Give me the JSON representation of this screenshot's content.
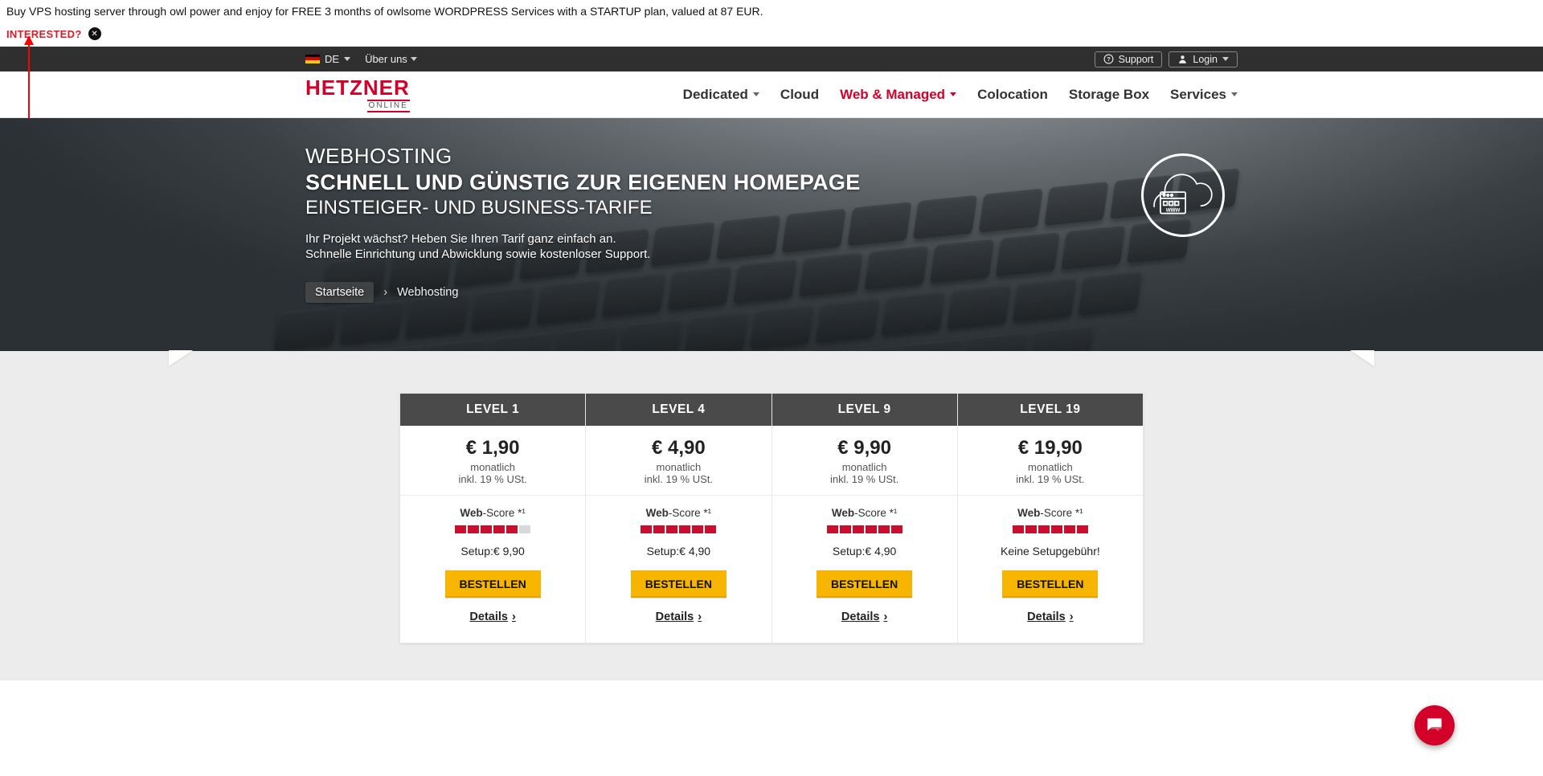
{
  "promo": {
    "text": "Buy VPS hosting server through owl power and enjoy for FREE 3 months of owlsome WORDPRESS Services with a STARTUP plan, valued at 87 EUR.",
    "interested": "INTERESTED?"
  },
  "topbar": {
    "lang_code": "DE",
    "about": "Über uns",
    "support": "Support",
    "login": "Login"
  },
  "logo": {
    "main": "HETZNER",
    "sub": "ONLINE"
  },
  "nav": {
    "dedicated": "Dedicated",
    "cloud": "Cloud",
    "web_managed": "Web & Managed",
    "colocation": "Colocation",
    "storage": "Storage Box",
    "services": "Services"
  },
  "hero": {
    "line1": "WEBHOSTING",
    "line2": "SCHNELL UND GÜNSTIG ZUR EIGENEN HOMEPAGE",
    "line3": "EINSTEIGER- UND BUSINESS-TARIFE",
    "p1": "Ihr Projekt wächst? Heben Sie Ihren Tarif ganz einfach an.",
    "p2": "Schnelle Einrichtung und Abwicklung sowie kostenloser Support.",
    "bc_home": "Startseite",
    "bc_current": "Webhosting"
  },
  "pricing": {
    "period": "monatlich",
    "tax": "inkl. 19 % USt.",
    "webscore_label_bold": "Web",
    "webscore_label_rest": "-Score *¹",
    "order_label": "BESTELLEN",
    "details_label": "Details",
    "plans": [
      {
        "name": "LEVEL 1",
        "price": "€ 1,90",
        "score": 5,
        "setup": "Setup:€ 9,90"
      },
      {
        "name": "LEVEL 4",
        "price": "€ 4,90",
        "score": 6,
        "setup": "Setup:€ 4,90"
      },
      {
        "name": "LEVEL 9",
        "price": "€ 9,90",
        "score": 6,
        "setup": "Setup:€ 4,90"
      },
      {
        "name": "LEVEL 19",
        "price": "€ 19,90",
        "score": 6,
        "setup": "Keine Setupgebühr!"
      }
    ]
  }
}
